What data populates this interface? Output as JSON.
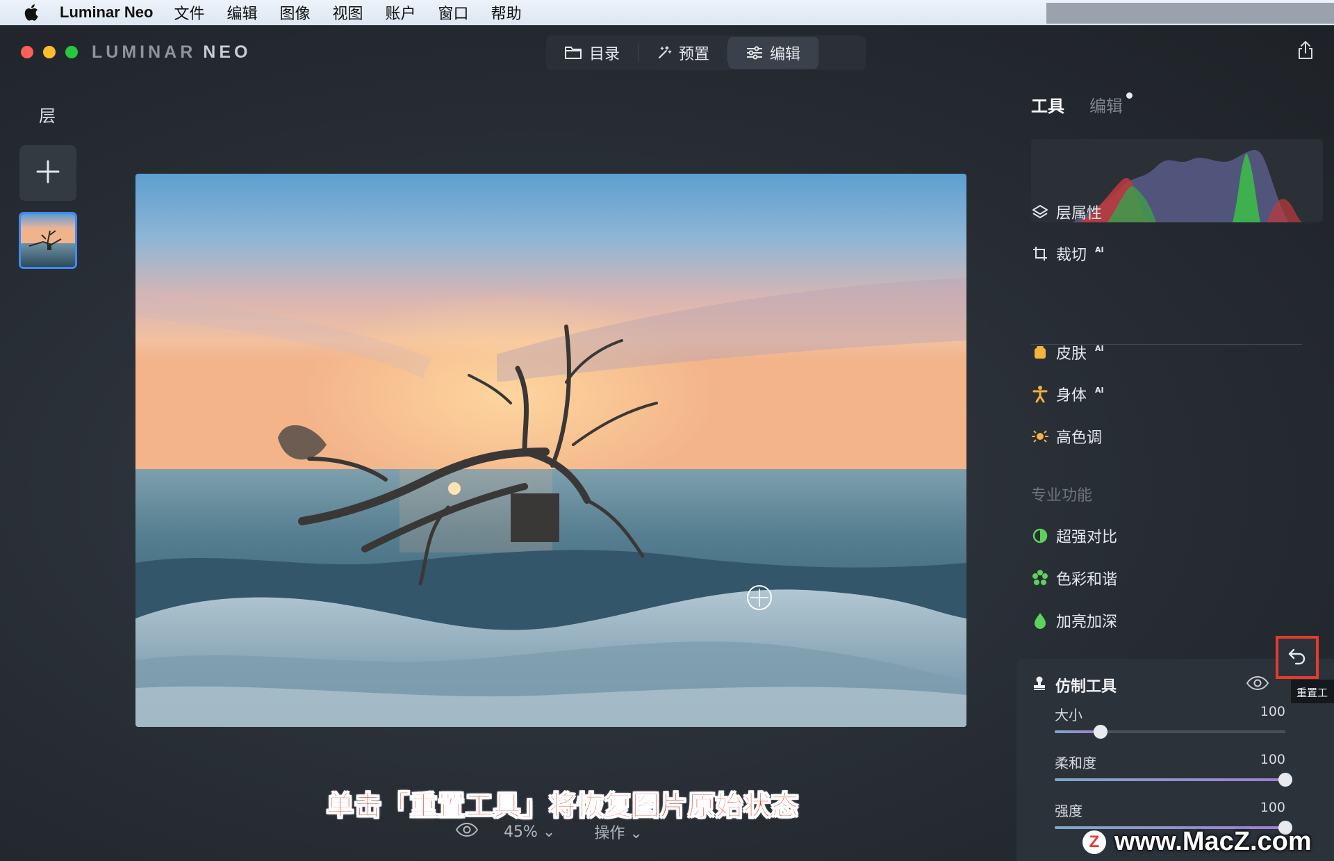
{
  "menubar": {
    "app_name": "Luminar Neo",
    "items": [
      "文件",
      "编辑",
      "图像",
      "视图",
      "账户",
      "窗口",
      "帮助"
    ]
  },
  "titlebar": {
    "brand_primary": "LUMINAR",
    "brand_secondary": "NEO",
    "modes": [
      {
        "label": "目录",
        "icon": "folder-icon",
        "active": false
      },
      {
        "label": "预置",
        "icon": "magic-wand-icon",
        "active": false
      },
      {
        "label": "编辑",
        "icon": "sliders-icon",
        "active": true
      }
    ],
    "share_icon": "share-icon"
  },
  "layers": {
    "title": "层",
    "add_icon": "plus-icon"
  },
  "panel": {
    "tabs": {
      "tools": "工具",
      "edits": "编辑"
    },
    "tools": [
      {
        "label": "层属性",
        "icon": "layers-icon",
        "ai": ""
      },
      {
        "label": "裁切",
        "icon": "crop-icon",
        "ai": "AI"
      },
      {
        "label": "皮肤",
        "icon": "skin-icon",
        "ai": "AI"
      },
      {
        "label": "身体",
        "icon": "body-icon",
        "ai": "AI"
      },
      {
        "label": "高色调",
        "icon": "high-key-icon",
        "ai": ""
      }
    ],
    "pro_section_title": "专业功能",
    "pro_tools": [
      {
        "label": "超强对比",
        "icon": "contrast-icon"
      },
      {
        "label": "色彩和谐",
        "icon": "color-harmony-icon"
      },
      {
        "label": "加亮加深",
        "icon": "dodge-burn-icon"
      }
    ],
    "clone": {
      "title": "仿制工具",
      "reset_tooltip": "重置工",
      "sliders": [
        {
          "label": "大小",
          "value": "100",
          "level": 0.2
        },
        {
          "label": "柔和度",
          "value": "100",
          "level": 1.0
        },
        {
          "label": "强度",
          "value": "100",
          "level": 1.0
        }
      ]
    }
  },
  "bottombar": {
    "zoom": "45%",
    "actions": "操作"
  },
  "caption": "单击「重置工具」将恢复图片原始状态",
  "watermark": "www.MacZ.com",
  "colors": {
    "accent_blue": "#3f8bf0",
    "highlight_red": "#e53b2f",
    "close_red": "#ff5f57",
    "minimize_yellow": "#febc2e",
    "zoom_green": "#28c840"
  }
}
